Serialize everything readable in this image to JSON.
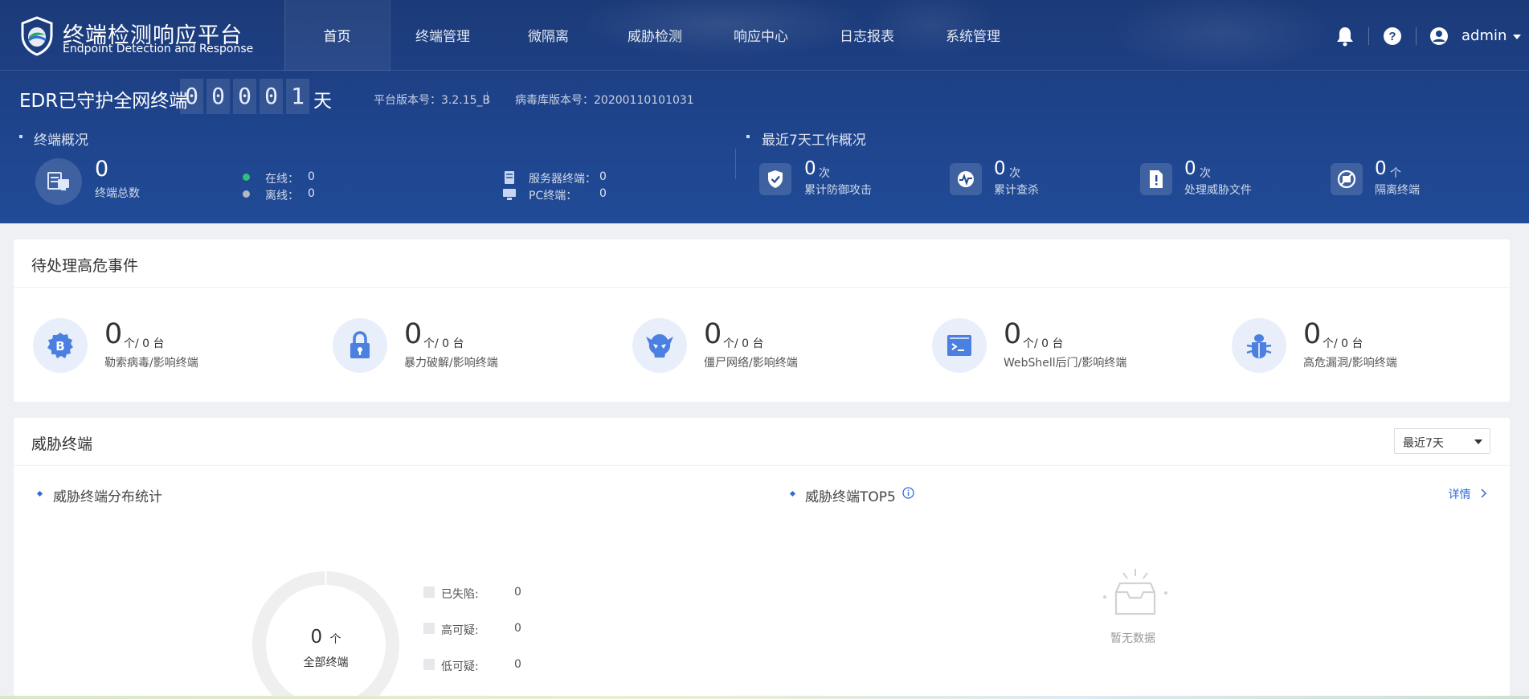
{
  "brand": {
    "title": "终端检测响应平台",
    "subtitle": "Endpoint Detection and Response"
  },
  "nav": {
    "items": [
      {
        "label": "首页",
        "active": true
      },
      {
        "label": "终端管理",
        "active": false
      },
      {
        "label": "微隔离",
        "active": false
      },
      {
        "label": "威胁检测",
        "active": false
      },
      {
        "label": "响应中心",
        "active": false
      },
      {
        "label": "日志报表",
        "active": false
      },
      {
        "label": "系统管理",
        "active": false
      }
    ],
    "user": "admin",
    "icons": [
      "bell-icon",
      "help-icon",
      "user-icon",
      "caret-down-icon"
    ]
  },
  "guard": {
    "label": "EDR已守护全网终端",
    "digits": [
      "0",
      "0",
      "0",
      "0",
      "1"
    ],
    "unit": "天"
  },
  "versions": {
    "platform": "平台版本号：3.2.15_B",
    "virus_db": "病毒库版本号：20200110101031"
  },
  "overview": {
    "title": "终端概况",
    "total": {
      "value": "0",
      "label": "终端总数"
    },
    "online": {
      "label": "在线：",
      "value": "0",
      "color": "#2fc17a"
    },
    "offline": {
      "label": "离线：",
      "value": "0",
      "color": "#b4b8c0"
    },
    "server": {
      "label": "服务器终端：",
      "value": "0"
    },
    "pc": {
      "label": "PC终端：",
      "value": "0"
    }
  },
  "week": {
    "title": "最近7天工作概况",
    "items": [
      {
        "value": "0",
        "unit": "次",
        "label": "累计防御攻击",
        "icon": "shield-check-icon"
      },
      {
        "value": "0",
        "unit": "次",
        "label": "累计查杀",
        "icon": "scan-icon"
      },
      {
        "value": "0",
        "unit": "次",
        "label": "处理威胁文件",
        "icon": "file-alert-icon"
      },
      {
        "value": "0",
        "unit": "个",
        "label": "隔离终端",
        "icon": "isolate-icon"
      }
    ]
  },
  "events": {
    "title": "待处理高危事件",
    "items": [
      {
        "value": "0",
        "unit": "个/ 0 台",
        "label": "勒索病毒/影响终端",
        "icon": "bitcoin-icon"
      },
      {
        "value": "0",
        "unit": "个/ 0 台",
        "label": "暴力破解/影响终端",
        "icon": "lock-icon"
      },
      {
        "value": "0",
        "unit": "个/ 0 台",
        "label": "僵尸网络/影响终端",
        "icon": "skull-icon"
      },
      {
        "value": "0",
        "unit": "个/ 0 台",
        "label": "WebShell后门/影响终端",
        "icon": "terminal-icon"
      },
      {
        "value": "0",
        "unit": "个/ 0 台",
        "label": "高危漏洞/影响终端",
        "icon": "bug-icon"
      }
    ]
  },
  "threat": {
    "title": "威胁终端",
    "range": "最近7天",
    "dist_title": "威胁终端分布统计",
    "top5_title": "威胁终端TOP5",
    "detail": "详情",
    "donut": {
      "value": "0",
      "unit": "个",
      "label": "全部终端"
    },
    "legend": [
      {
        "label": "已失陷:",
        "value": "0"
      },
      {
        "label": "高可疑:",
        "value": "0"
      },
      {
        "label": "低可疑:",
        "value": "0"
      }
    ],
    "empty": "暂无数据"
  }
}
